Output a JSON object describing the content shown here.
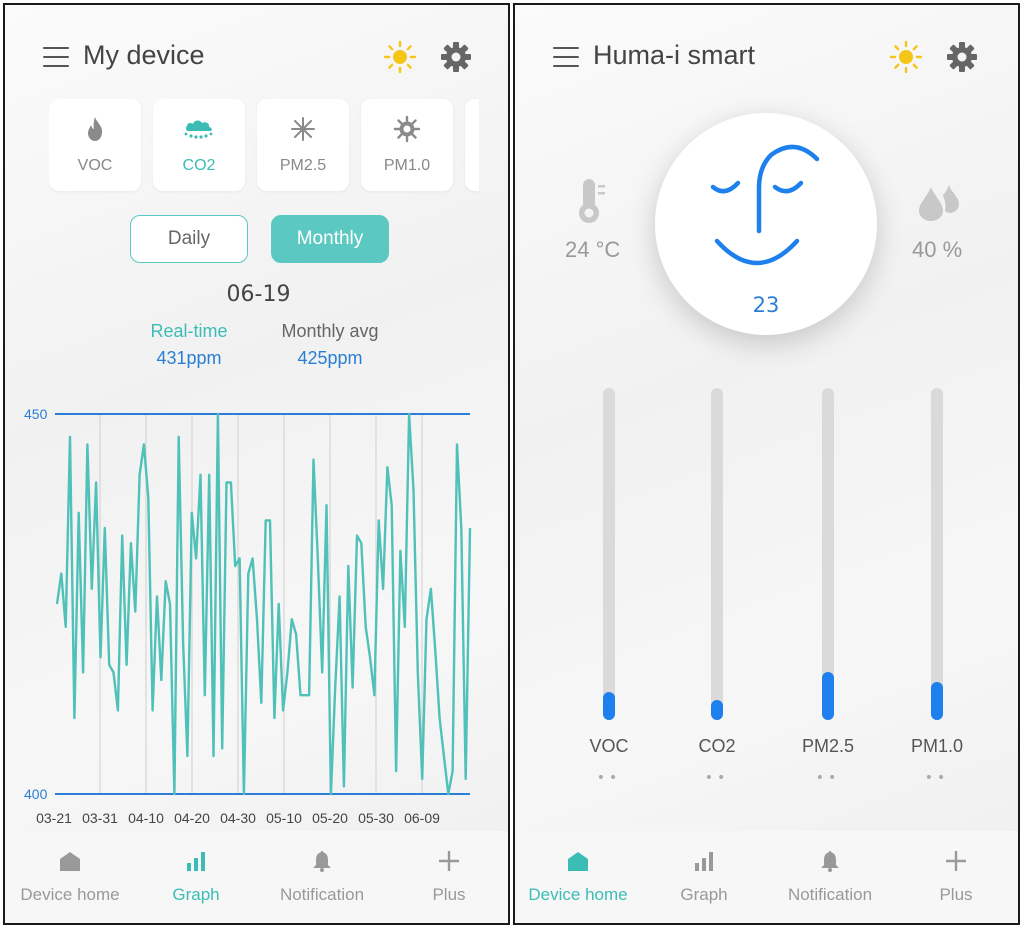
{
  "left": {
    "title": "My device",
    "cards": [
      {
        "label": "VOC",
        "icon": "flame-icon"
      },
      {
        "label": "CO2",
        "icon": "cloud-drops-icon",
        "active": true
      },
      {
        "label": "PM2.5",
        "icon": "snowflake-icon"
      },
      {
        "label": "PM1.0",
        "icon": "sun-gear-icon"
      }
    ],
    "toggle": {
      "daily": "Daily",
      "monthly": "Monthly",
      "selected": "Monthly"
    },
    "date": "06-19",
    "realtime": {
      "label": "Real-time",
      "value": "431ppm"
    },
    "monthly_avg": {
      "label": "Monthly avg",
      "value": "425ppm"
    },
    "nav": [
      {
        "label": "Device home",
        "icon": "home-icon"
      },
      {
        "label": "Graph",
        "icon": "bar-chart-icon",
        "active": true
      },
      {
        "label": "Notification",
        "icon": "bell-icon"
      },
      {
        "label": "Plus",
        "icon": "plus-icon"
      }
    ]
  },
  "right": {
    "title": "Huma-i smart",
    "aqi": "23",
    "temperature": "24 °C",
    "humidity": "40 %",
    "gauges": [
      {
        "label": "VOC",
        "level": 0.085,
        "dots": "••"
      },
      {
        "label": "CO2",
        "level": 0.06,
        "dots": "••"
      },
      {
        "label": "PM2.5",
        "level": 0.145,
        "dots": "••"
      },
      {
        "label": "PM1.0",
        "level": 0.115,
        "dots": "••"
      }
    ],
    "nav": [
      {
        "label": "Device home",
        "icon": "home-icon",
        "active": true
      },
      {
        "label": "Graph",
        "icon": "bar-chart-icon"
      },
      {
        "label": "Notification",
        "icon": "bell-icon"
      },
      {
        "label": "Plus",
        "icon": "plus-icon"
      }
    ]
  },
  "colors": {
    "teal": "#3bbdb5",
    "blue": "#2a7fd4",
    "gauge_fill": "#1e80ec",
    "sun": "#f5c518"
  },
  "chart_data": {
    "type": "line",
    "ylim": [
      400,
      450
    ],
    "y_ticks": [
      "450",
      "400"
    ],
    "x_ticks": [
      "03-21",
      "03-31",
      "04-10",
      "04-20",
      "04-30",
      "05-10",
      "05-20",
      "05-30",
      "06-09"
    ],
    "series": [
      {
        "values": [
          425,
          429,
          422,
          447,
          410,
          437,
          416,
          446,
          427,
          441,
          418,
          435,
          417,
          416,
          411,
          434,
          417,
          433,
          424,
          442,
          446,
          439,
          411,
          426,
          415,
          428,
          425,
          400,
          447,
          420,
          405,
          437,
          431,
          442,
          413,
          442,
          405,
          450,
          406,
          441,
          441,
          430,
          431,
          400,
          429,
          431,
          423,
          412,
          436,
          436,
          410,
          425,
          411,
          416,
          423,
          421,
          413,
          413,
          413,
          444,
          431,
          416,
          438,
          400,
          414,
          426,
          401,
          430,
          414,
          434,
          433,
          422,
          418,
          413,
          436,
          427,
          443,
          438,
          403,
          432,
          422,
          450,
          440,
          416,
          402,
          423,
          427,
          419,
          410,
          405,
          400,
          403,
          446,
          435,
          402,
          435
        ]
      }
    ]
  }
}
